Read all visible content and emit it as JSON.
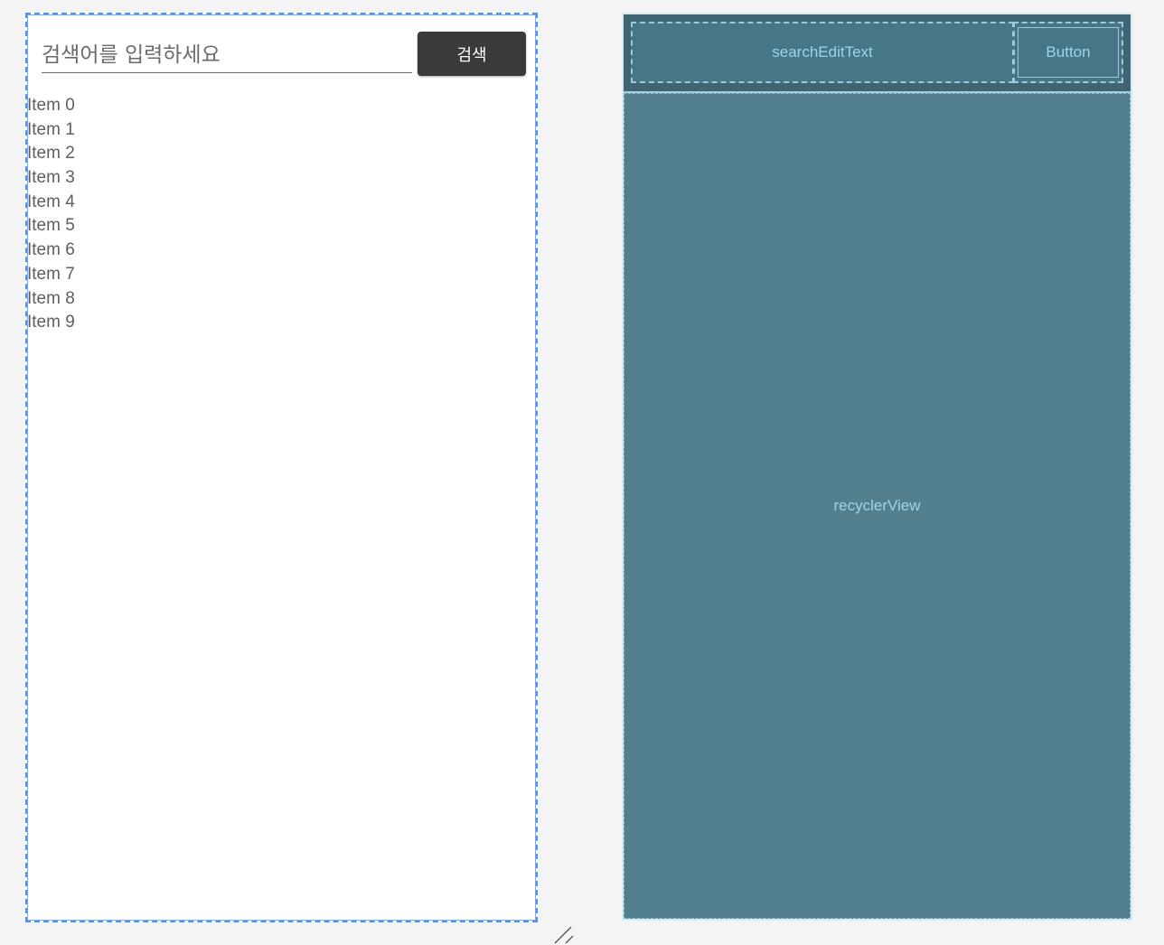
{
  "design": {
    "search_placeholder": "검색어를 입력하세요",
    "search_button_label": "검색",
    "items": [
      "Item 0",
      "Item 1",
      "Item 2",
      "Item 3",
      "Item 4",
      "Item 5",
      "Item 6",
      "Item 7",
      "Item 8",
      "Item 9"
    ]
  },
  "blueprint": {
    "edittext_label": "searchEditText",
    "button_label": "Button",
    "recycler_label": "recyclerView"
  },
  "colors": {
    "canvas_background": "#f4f4f4",
    "selection_outline": "#5b8fd8",
    "button_background": "#3a3a3a",
    "blueprint_background": "#53808f",
    "blueprint_text": "#9ed3e8"
  },
  "icons": {
    "resize_handle": "resize-handle-icon"
  }
}
